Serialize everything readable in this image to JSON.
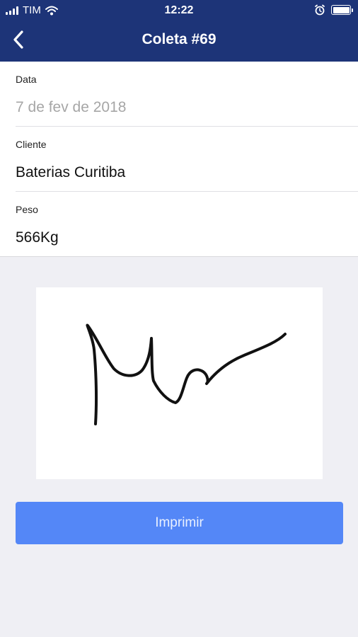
{
  "status_bar": {
    "carrier": "TIM",
    "time": "12:22"
  },
  "header": {
    "title": "Coleta #69"
  },
  "fields": [
    {
      "label": "Data",
      "value": "7 de fev de 2018"
    },
    {
      "label": "Cliente",
      "value": "Baterias Curitiba"
    },
    {
      "label": "Peso",
      "value": "566Kg"
    }
  ],
  "actions": {
    "print_label": "Imprimir"
  },
  "colors": {
    "header": "#1d3478",
    "button": "#5487f7",
    "background": "#efeff4"
  },
  "icons": [
    "signal-icon",
    "wifi-icon",
    "alarm-icon",
    "battery-icon",
    "back-chevron-icon"
  ]
}
